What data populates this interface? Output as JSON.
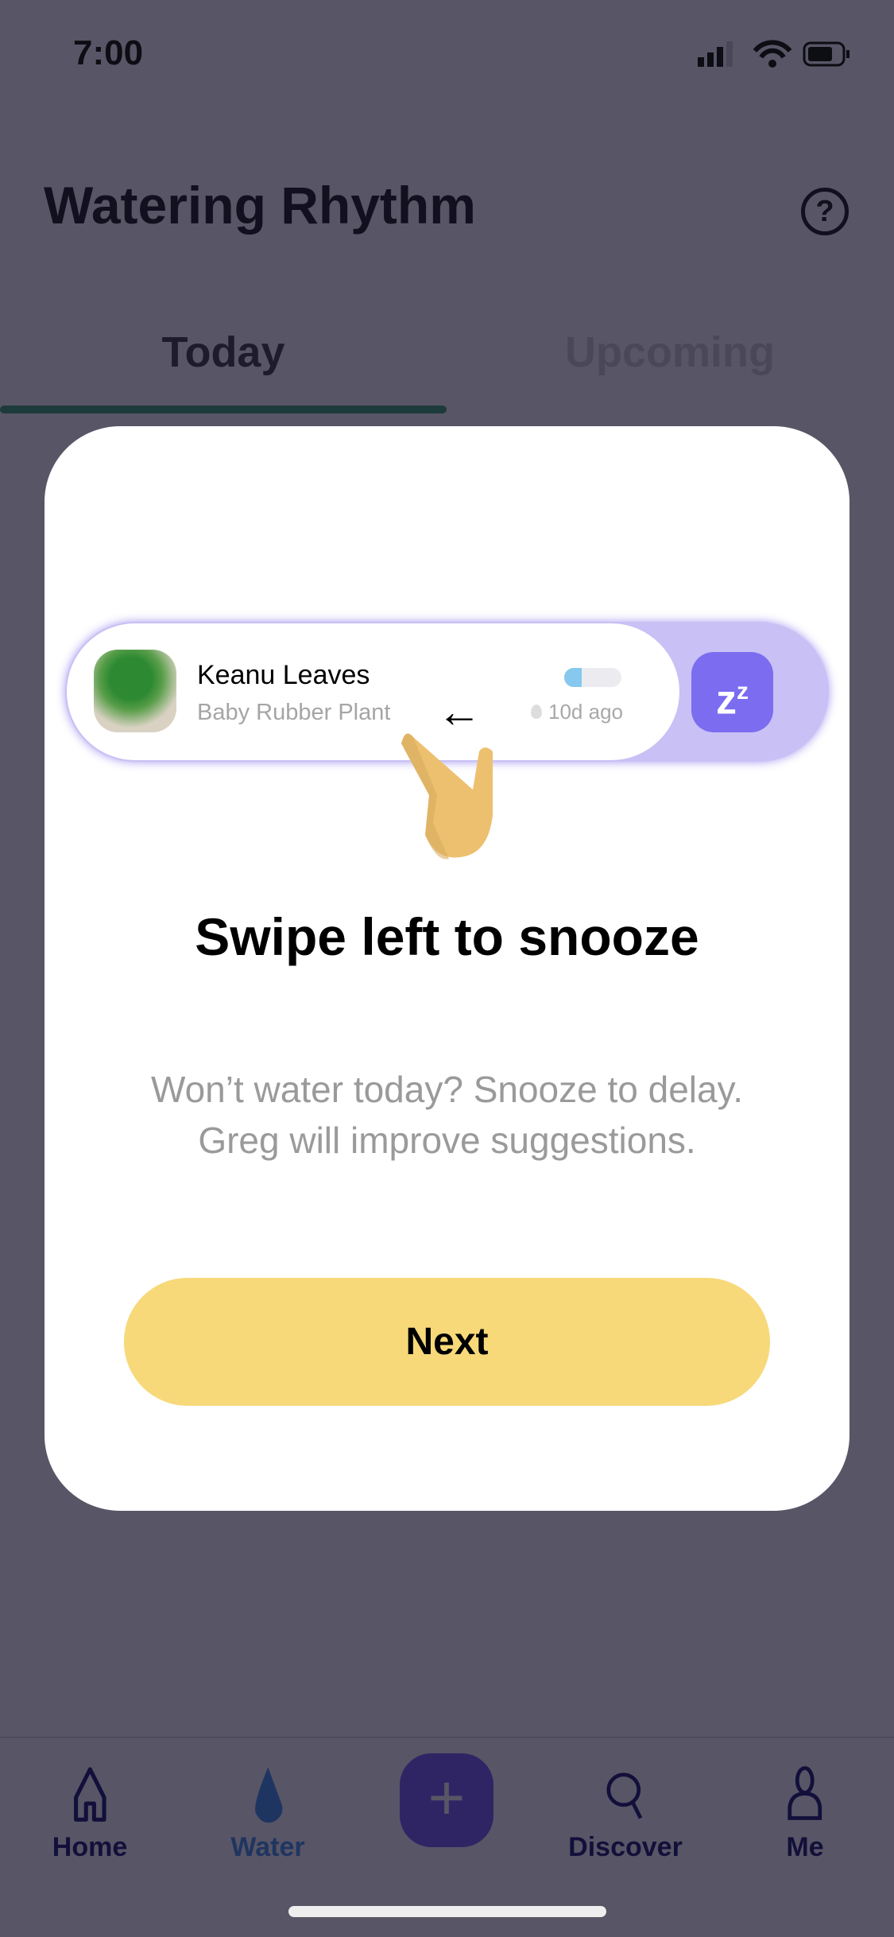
{
  "status": {
    "time": "7:00"
  },
  "header": {
    "title": "Watering Rhythm"
  },
  "tabs": [
    {
      "label": "Today",
      "active": true
    },
    {
      "label": "Upcoming",
      "active": false
    }
  ],
  "modal": {
    "plant": {
      "name": "Keanu Leaves",
      "species": "Baby Rubber Plant",
      "last_watered": "10d ago",
      "water_level": 0.3
    },
    "heading": "Swipe left to snooze",
    "body_line1": "Won’t water today? Snooze to delay.",
    "body_line2": "Greg will improve suggestions.",
    "next_label": "Next"
  },
  "nav": {
    "items": [
      {
        "label": "Home",
        "icon": "home-icon"
      },
      {
        "label": "Water",
        "icon": "water-drop-icon",
        "active": true
      },
      {
        "label": "Discover",
        "icon": "search-icon"
      },
      {
        "label": "Me",
        "icon": "person-icon"
      }
    ]
  },
  "colors": {
    "accent": "#7b6cf0",
    "button": "#f7d97a",
    "overlay": "#585566"
  }
}
